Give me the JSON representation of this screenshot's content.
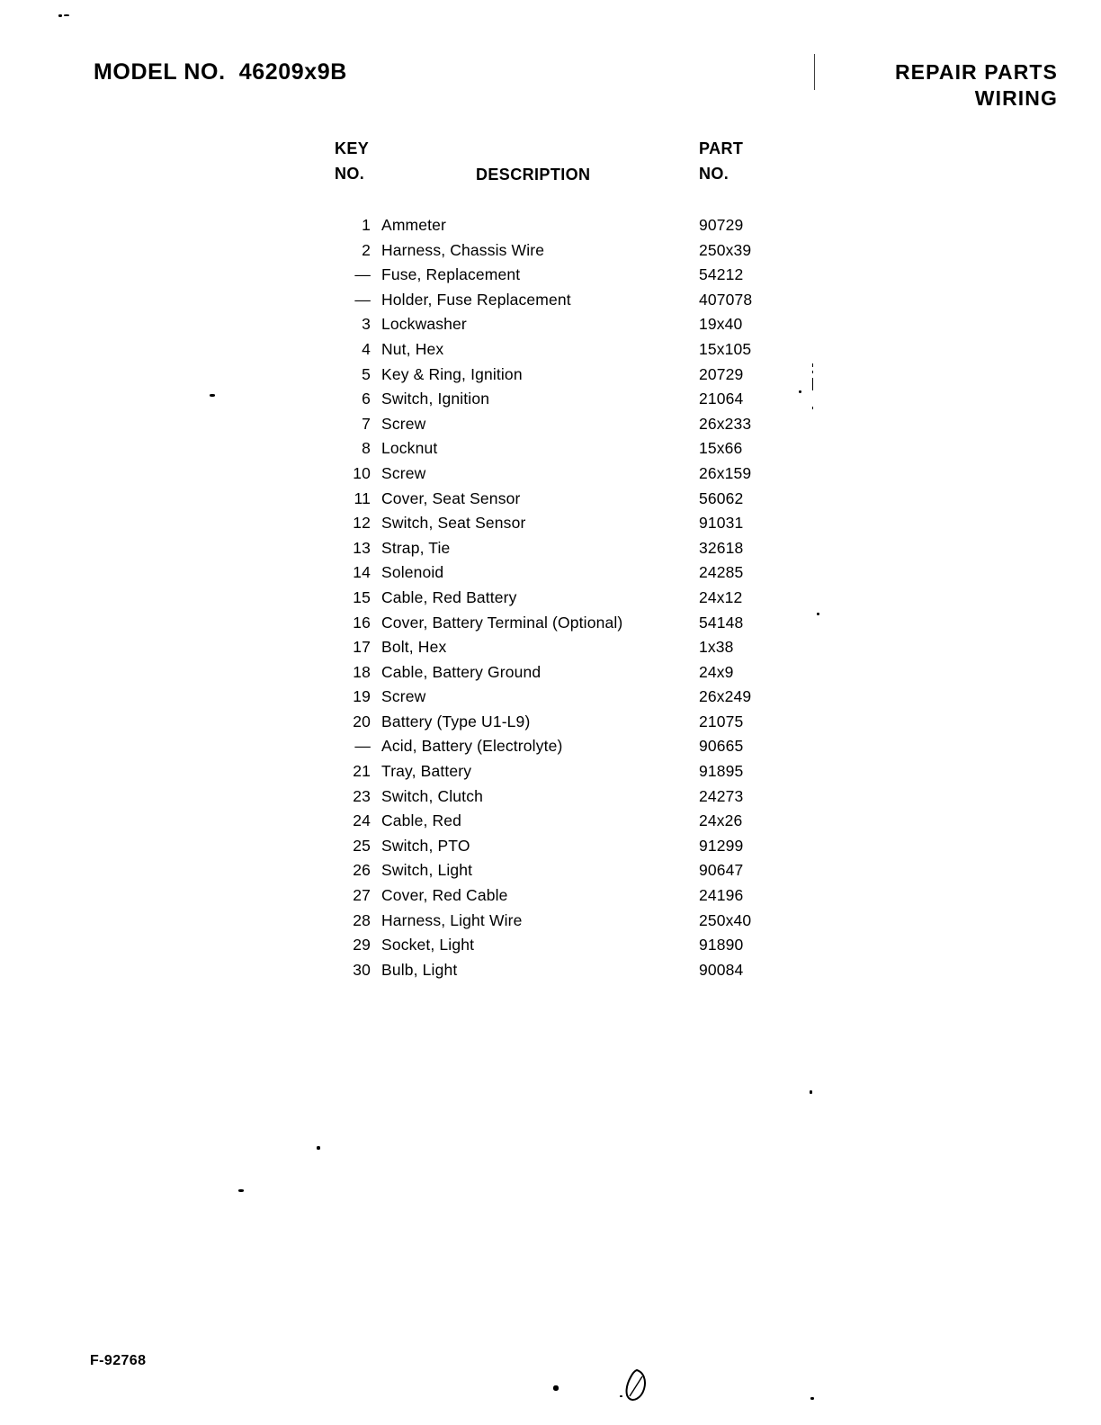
{
  "document": {
    "model_label": "MODEL NO.  46209x9B",
    "header_line1": "REPAIR  PARTS",
    "header_line2": "WIRING",
    "footer_code": "F-92768"
  },
  "table": {
    "headers": {
      "key_line1": "KEY",
      "key_line2": "NO.",
      "description": "DESCRIPTION",
      "part_line1": "PART",
      "part_line2": "NO."
    },
    "rows": [
      {
        "key": "1",
        "description": "Ammeter",
        "part": "90729"
      },
      {
        "key": "2",
        "description": "Harness, Chassis Wire",
        "part": "250x39"
      },
      {
        "key": "—",
        "description": "Fuse, Replacement",
        "part": "54212"
      },
      {
        "key": "—",
        "description": "Holder, Fuse Replacement",
        "part": "407078"
      },
      {
        "key": "3",
        "description": "Lockwasher",
        "part": "19x40"
      },
      {
        "key": "4",
        "description": "Nut, Hex",
        "part": "15x105"
      },
      {
        "key": "5",
        "description": "Key & Ring, Ignition",
        "part": "20729"
      },
      {
        "key": "6",
        "description": "Switch, Ignition",
        "part": "21064"
      },
      {
        "key": "7",
        "description": "Screw",
        "part": "26x233"
      },
      {
        "key": "8",
        "description": "Locknut",
        "part": "15x66"
      },
      {
        "key": "10",
        "description": "Screw",
        "part": "26x159"
      },
      {
        "key": "11",
        "description": "Cover, Seat Sensor",
        "part": "56062"
      },
      {
        "key": "12",
        "description": "Switch, Seat Sensor",
        "part": "91031"
      },
      {
        "key": "13",
        "description": "Strap, Tie",
        "part": "32618"
      },
      {
        "key": "14",
        "description": "Solenoid",
        "part": "24285"
      },
      {
        "key": "15",
        "description": "Cable, Red Battery",
        "part": "24x12"
      },
      {
        "key": "16",
        "description": "Cover, Battery Terminal (Optional)",
        "part": "54148"
      },
      {
        "key": "17",
        "description": "Bolt, Hex",
        "part": "1x38"
      },
      {
        "key": "18",
        "description": "Cable, Battery Ground",
        "part": "24x9"
      },
      {
        "key": "19",
        "description": "Screw",
        "part": "26x249"
      },
      {
        "key": "20",
        "description": "Battery (Type U1-L9)",
        "part": "21075"
      },
      {
        "key": "—",
        "description": "Acid, Battery (Electrolyte)",
        "part": "90665"
      },
      {
        "key": "21",
        "description": "Tray, Battery",
        "part": "91895"
      },
      {
        "key": "23",
        "description": "Switch, Clutch",
        "part": "24273"
      },
      {
        "key": "24",
        "description": "Cable, Red",
        "part": "24x26"
      },
      {
        "key": "25",
        "description": "Switch, PTO",
        "part": "91299"
      },
      {
        "key": "26",
        "description": "Switch, Light",
        "part": "90647"
      },
      {
        "key": "27",
        "description": "Cover, Red Cable",
        "part": "24196"
      },
      {
        "key": "28",
        "description": "Harness, Light Wire",
        "part": "250x40"
      },
      {
        "key": "29",
        "description": "Socket, Light",
        "part": "91890"
      },
      {
        "key": "30",
        "description": "Bulb, Light",
        "part": "90084"
      }
    ]
  },
  "colors": {
    "ink": "#000000",
    "paper": "#ffffff"
  }
}
